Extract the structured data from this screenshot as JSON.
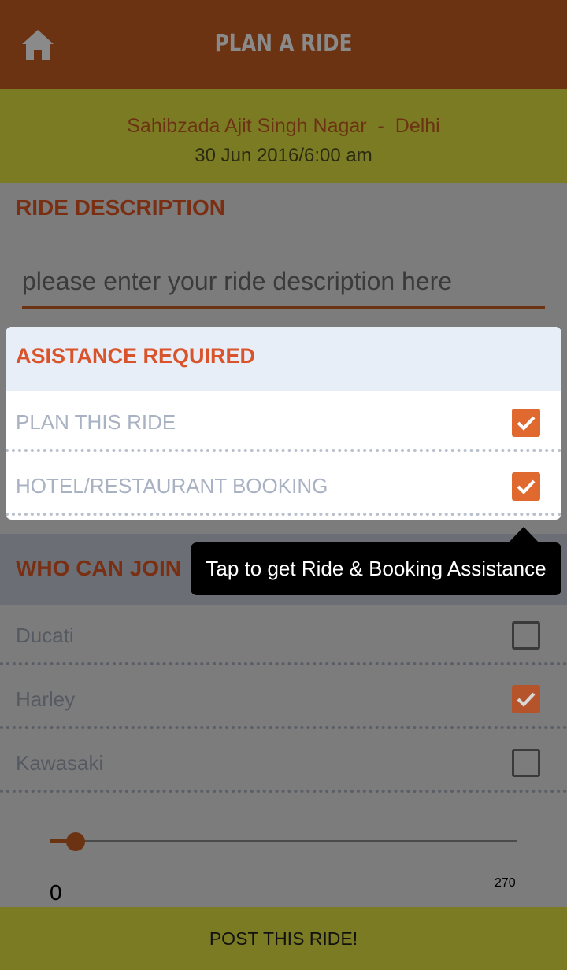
{
  "header": {
    "title": "PLAN A RIDE",
    "home_icon": "home-icon"
  },
  "route": {
    "from": "Sahibzada Ajit Singh Nagar",
    "separator": "-",
    "to": "Delhi",
    "datetime": "30 Jun 2016/6:00 am"
  },
  "description": {
    "title": "RIDE DESCRIPTION",
    "placeholder": "please enter your ride description here",
    "value": ""
  },
  "assistance": {
    "title": "ASISTANCE REQUIRED",
    "items": [
      {
        "label": "PLAN THIS RIDE",
        "checked": true
      },
      {
        "label": "HOTEL/RESTAURANT BOOKING",
        "checked": true
      }
    ]
  },
  "tooltip": {
    "text": "Tap to get Ride & Booking Assistance"
  },
  "join": {
    "title": "WHO CAN JOIN",
    "items": [
      {
        "label": "Ducati",
        "checked": false
      },
      {
        "label": "Harley",
        "checked": true
      },
      {
        "label": "Kawasaki",
        "checked": false
      }
    ]
  },
  "slider": {
    "min_label": "0",
    "max_label": "270",
    "value": 0
  },
  "footer": {
    "post_label": "POST THIS RIDE!"
  },
  "colors": {
    "header_bg": "#6c3313",
    "band_bg": "#7b7b24",
    "accent": "#e0692f",
    "title_red": "#d9542b"
  }
}
